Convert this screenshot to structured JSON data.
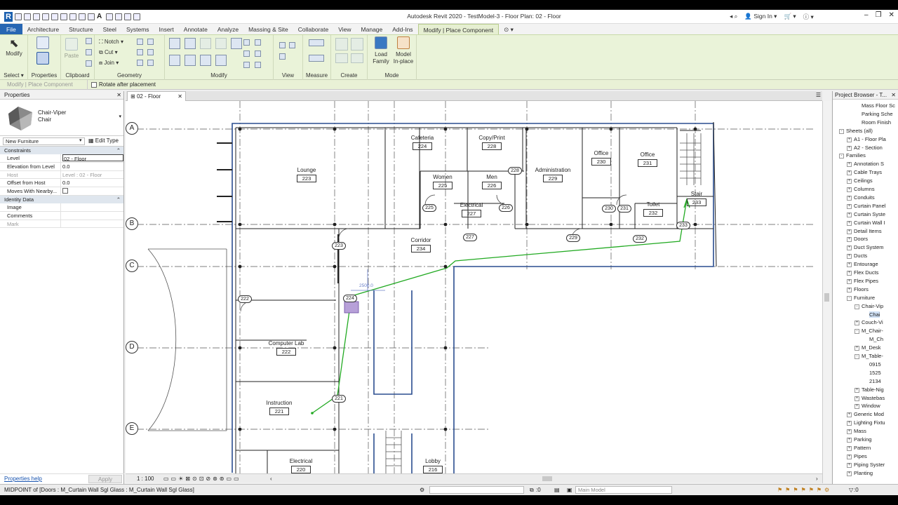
{
  "title": "Autodesk Revit 2020 - TestModel-3 - Floor Plan: 02 - Floor",
  "sign_in": "Sign In",
  "tabs": [
    "File",
    "Architecture",
    "Structure",
    "Steel",
    "Systems",
    "Insert",
    "Annotate",
    "Analyze",
    "Massing & Site",
    "Collaborate",
    "View",
    "Manage",
    "Add-Ins",
    "Modify | Place Component"
  ],
  "ribbon": {
    "modify": "Modify",
    "paste": "Paste",
    "notch": "Notch",
    "cut": "Cut",
    "join": "Join",
    "load_family": [
      "Load",
      "Family"
    ],
    "model_inplace": [
      "Model",
      "In-place"
    ],
    "groups": {
      "select": "Select",
      "properties": "Properties",
      "clipboard": "Clipboard",
      "geometry": "Geometry",
      "modify": "Modify",
      "view": "View",
      "measure": "Measure",
      "create": "Create",
      "mode": "Mode"
    }
  },
  "options_bar": {
    "context": "Modify | Place Component",
    "rotate": "Rotate after placement"
  },
  "properties": {
    "title": "Properties",
    "family": "Chair-Viper",
    "type": "Chair",
    "category": "New Furniture",
    "edit_type": "Edit Type",
    "constraints": "Constraints",
    "rows": [
      [
        "Level",
        "02 - Floor"
      ],
      [
        "Elevation from Level",
        "0.0"
      ],
      [
        "Host",
        "Level : 02 - Floor"
      ],
      [
        "Offset from Host",
        "0.0"
      ],
      [
        "Moves With Nearby...",
        ""
      ]
    ],
    "identity": "Identity Data",
    "id_rows": [
      [
        "Image",
        ""
      ],
      [
        "Comments",
        ""
      ],
      [
        "Mark",
        ""
      ]
    ],
    "help": "Properties help",
    "apply": "Apply"
  },
  "view": {
    "tab": "02 - Floor",
    "scale": "1 : 100"
  },
  "grid": [
    "A",
    "B",
    "C",
    "D",
    "E"
  ],
  "rooms": [
    {
      "name": "Lounge",
      "num": "223"
    },
    {
      "name": "Cafeteria",
      "num": "224"
    },
    {
      "name": "Copy/Print",
      "num": "228"
    },
    {
      "name": "Women",
      "num": "225"
    },
    {
      "name": "Men",
      "num": "226"
    },
    {
      "name": "Electrical",
      "num": "227"
    },
    {
      "name": "Administration",
      "num": "229"
    },
    {
      "name": "Office",
      "num": "230"
    },
    {
      "name": "Office",
      "num": "231"
    },
    {
      "name": "Toilet",
      "num": "232"
    },
    {
      "name": "Stair",
      "num": "233"
    },
    {
      "name": "Corridor",
      "num": "234"
    },
    {
      "name": "Computer Lab",
      "num": "222"
    },
    {
      "name": "Instruction",
      "num": "221"
    },
    {
      "name": "Electrical",
      "num": "220"
    },
    {
      "name": "Lobby",
      "num": "216"
    }
  ],
  "tags": [
    "228",
    "225",
    "226",
    "227",
    "223",
    "222",
    "221",
    "230",
    "231",
    "229",
    "232",
    "233",
    "224"
  ],
  "dim_label": "2500.0",
  "browser": {
    "title": "Project Browser - T...",
    "items": [
      "Mass Floor Sc",
      "Parking Sche",
      "Room Finish",
      "Sheets (all)",
      "A1 - Floor Pla",
      "A2 - Section",
      "Families",
      "Annotation S",
      "Cable Trays",
      "Ceilings",
      "Columns",
      "Conduits",
      "Curtain Panel",
      "Curtain Syste",
      "Curtain Wall I",
      "Detail Items",
      "Doors",
      "Duct System",
      "Ducts",
      "Entourage",
      "Flex Ducts",
      "Flex Pipes",
      "Floors",
      "Furniture",
      "Chair-Vip",
      "Chai",
      "Couch-Vi",
      "M_Chair-",
      "M_Ch",
      "M_Desk",
      "M_Table-",
      "0915",
      "1525",
      "2134",
      "Table-Nig",
      "Wastebas",
      "Window",
      "Generic Mod",
      "Lighting Fixtu",
      "Mass",
      "Parking",
      "Pattern",
      "Pipes",
      "Piping Syster",
      "Planting"
    ]
  },
  "status": {
    "text": "MIDPOINT of [Doors : M_Curtain Wall Sgl Glass : M_Curtain Wall Sgl Glass]",
    "zero": ":0",
    "model": "Main Model",
    "filter": ":0"
  }
}
